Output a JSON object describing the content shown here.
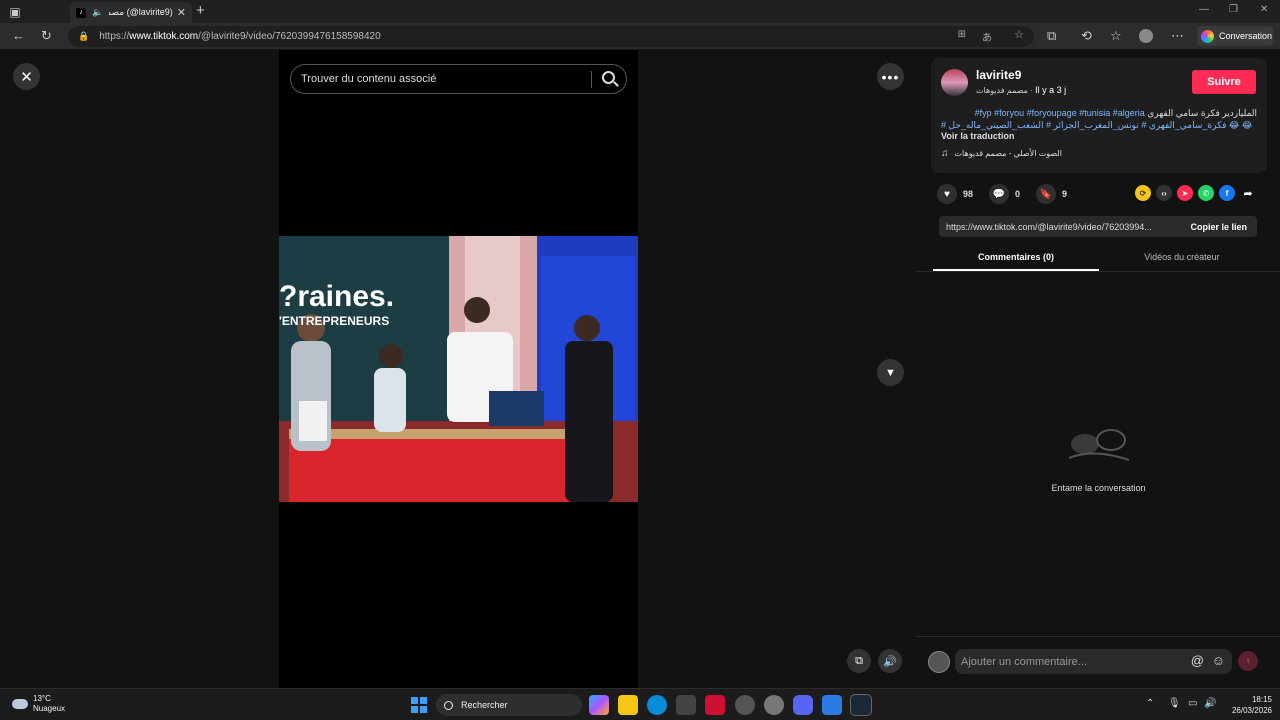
{
  "browser": {
    "tab_title": "(lavirite9@) مصمم فديوهات",
    "url_prefix": "https://",
    "url_host": "www.tiktok.com",
    "url_path": "/@lavirite9/video/7620399476158598420",
    "conversation_label": "Conversation"
  },
  "video": {
    "search_placeholder": "Trouver du contenu associé",
    "overlay_text_1": "?raines.",
    "overlay_text_2": "'ENTREPRENEURS"
  },
  "author": {
    "username": "lavirite9",
    "display_name": "مصمم فديوهات",
    "time_ago": "Il y a 3 j",
    "follow_label": "Suivre",
    "description_text": "الملياردير فكرة سامي الفهري",
    "description_tags": "#fyp #foryou #foryoupage #tunisia #algeria",
    "description_line2": "# فكرة_سامي_الفهري # تونس_المغرب_الجزائر # الشعب_الصيني_ماله_حل 😂 😂",
    "translate_label": "Voir la traduction",
    "music": "الصوت الأصلي - مصمم فديوهات"
  },
  "stats": {
    "likes": "98",
    "comments": "0",
    "saves": "9"
  },
  "share": {
    "link": "https://www.tiktok.com/@lavirite9/video/76203994...",
    "copy_label": "Copier le lien"
  },
  "tabs": [
    {
      "label": "Commentaires (0)",
      "active": true
    },
    {
      "label": "Vidéos du créateur",
      "active": false
    }
  ],
  "empty_state": "Entame la conversation",
  "comment_placeholder": "Ajouter un commentaire...",
  "taskbar": {
    "temperature": "13°C",
    "weather": "Nuageux",
    "search_label": "Rechercher",
    "time": "18:15",
    "date": "26/03/2026"
  },
  "colors": {
    "accent": "#fe2c55",
    "hashtag": "#7fb8ff",
    "background": "#121212"
  }
}
